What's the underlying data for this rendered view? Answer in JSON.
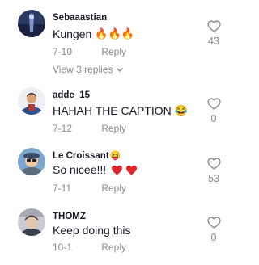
{
  "comments": [
    {
      "username": "Sebaaastian",
      "text": "Kungen",
      "emoji": "🔥🔥🔥",
      "date": "7-10",
      "reply_label": "Reply",
      "likes": "43",
      "view_replies": "View 3 replies"
    },
    {
      "username": "adde_15",
      "text": "HAHAH THE CAPTION",
      "emoji": "😂",
      "date": "7-12",
      "reply_label": "Reply",
      "likes": "0"
    },
    {
      "username": "Le Croissant",
      "username_emoji": "😝",
      "text": "So nicee!!!",
      "emoji": "❤️❤️",
      "date": "7-11",
      "reply_label": "Reply",
      "likes": "53"
    },
    {
      "username": "THOMZ",
      "text": "Keep doing this",
      "date": "10-1",
      "reply_label": "Reply",
      "likes": "0"
    }
  ],
  "colors": {
    "text": "#161823",
    "muted": "#8a8b91",
    "heart_red": "#e0242b"
  }
}
